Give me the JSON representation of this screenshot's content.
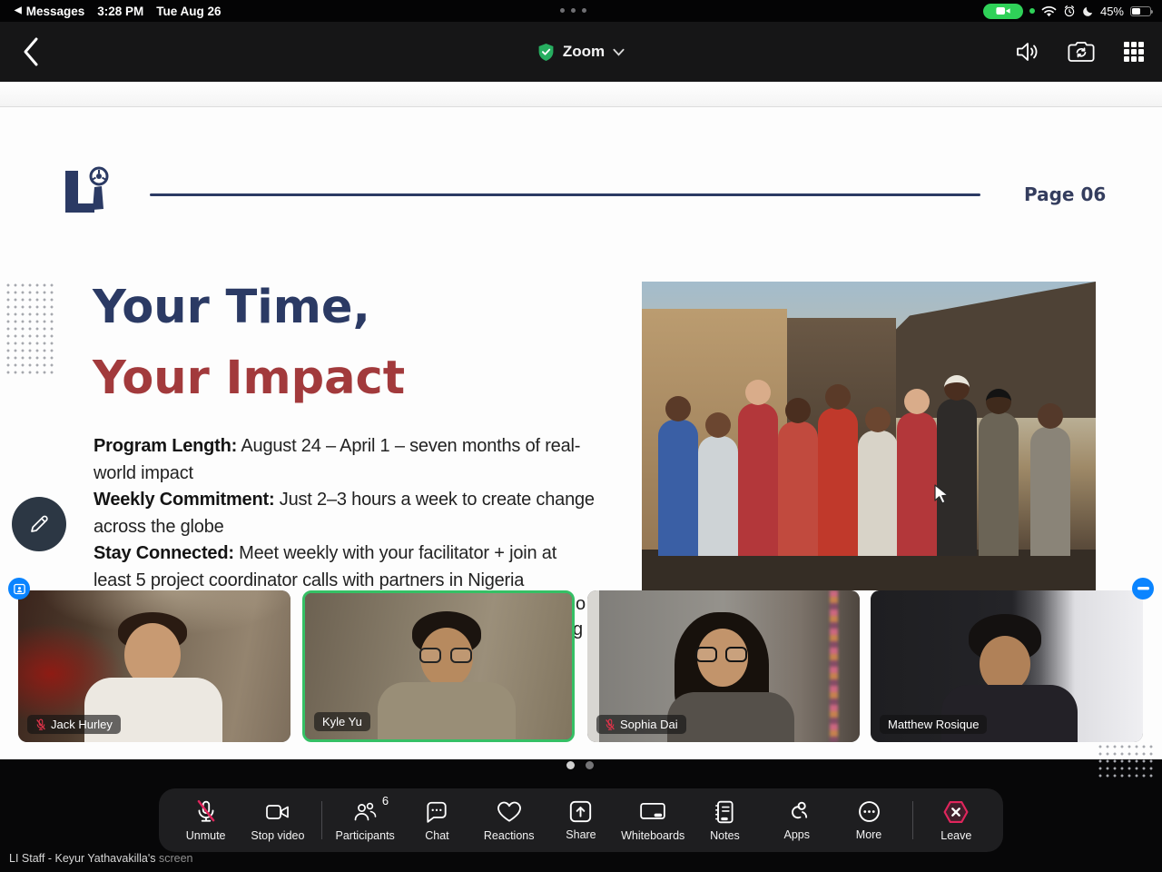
{
  "status_bar": {
    "back_link": "Messages",
    "time": "3:28 PM",
    "date": "Tue Aug 26",
    "battery_percent": "45%"
  },
  "app_bar": {
    "title": "Zoom"
  },
  "slide": {
    "page_label": "Page 06",
    "title_line1": "Your Time,",
    "title_line2": "Your Impact",
    "bullets": [
      {
        "label": "Program Length:",
        "text": " August 24 – April 1 – seven months of real-world impact"
      },
      {
        "label": "Weekly Commitment:",
        "text": " Just 2–3 hours a week to create change across the globe"
      },
      {
        "label": "Stay Connected:",
        "text": " Meet weekly with your facilitator + join at least 5 project coordinator calls with partners in Nigeria"
      }
    ],
    "clipped_fragments": [
      "o",
      "g"
    ]
  },
  "video_tiles": [
    {
      "name": "Jack Hurley",
      "muted": true,
      "active_speaker": false
    },
    {
      "name": "Kyle Yu",
      "muted": false,
      "active_speaker": true
    },
    {
      "name": "Sophia Dai",
      "muted": true,
      "active_speaker": false
    },
    {
      "name": "Matthew Rosique",
      "muted": false,
      "active_speaker": false
    }
  ],
  "toolbar": {
    "items": [
      {
        "label": "Unmute",
        "icon": "mic-muted-icon"
      },
      {
        "label": "Stop video",
        "icon": "video-camera-icon"
      },
      {
        "label": "Participants",
        "icon": "participants-icon",
        "badge": "6"
      },
      {
        "label": "Chat",
        "icon": "chat-bubble-icon"
      },
      {
        "label": "Reactions",
        "icon": "heart-icon"
      },
      {
        "label": "Share",
        "icon": "share-up-arrow-icon"
      },
      {
        "label": "Whiteboards",
        "icon": "whiteboard-icon"
      },
      {
        "label": "Notes",
        "icon": "notes-icon"
      },
      {
        "label": "Apps",
        "icon": "apps-icon"
      },
      {
        "label": "More",
        "icon": "more-ellipsis-icon"
      },
      {
        "label": "Leave",
        "icon": "leave-hexagon-icon"
      }
    ]
  },
  "footer": {
    "share_text": "LI Staff - Keyur Yathavakilla's",
    "share_suffix": "screen"
  },
  "colors": {
    "zoom_shield_green": "#27ae60",
    "active_speaker_border": "#35c065",
    "mute_red": "#e0334a",
    "leave_red": "#e0255c",
    "ios_blue": "#0a84ff",
    "slide_navy": "#2b3a64",
    "slide_red": "#a23a3c",
    "camera_pill_green": "#2fd158"
  }
}
